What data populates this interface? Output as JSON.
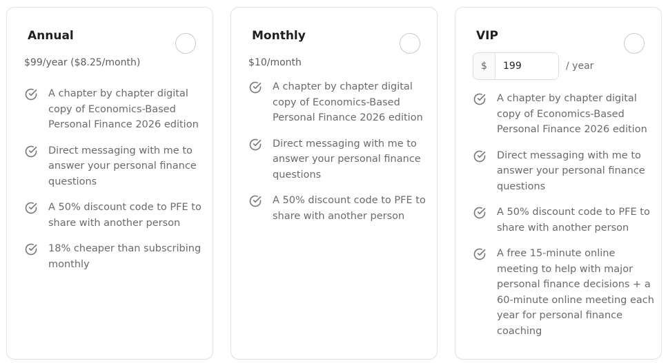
{
  "colors": {
    "border": "#e2e2e2",
    "text_muted": "#6a6a6a",
    "check_icon": "#7a7a7a"
  },
  "plans": [
    {
      "title": "Annual",
      "price": "$99/year ($8.25/month)",
      "features": [
        "A chapter by chapter digital copy of Economics-Based Personal Finance 2026 edition",
        "Direct messaging with me to answer your personal finance questions",
        "A 50% discount code to PFE to share with another person",
        "18% cheaper than subscribing monthly"
      ]
    },
    {
      "title": "Monthly",
      "price": "$10/month",
      "features": [
        "A chapter by chapter digital copy of Economics-Based Personal Finance 2026 edition",
        "Direct messaging with me to answer your personal finance questions",
        "A 50% discount code to PFE to share with another person"
      ]
    },
    {
      "title": "VIP",
      "currency": "$",
      "amount": "199",
      "period": "/ year",
      "features": [
        "A chapter by chapter digital copy of Economics-Based Personal Finance 2026 edition",
        "Direct messaging with me to answer your personal finance questions",
        "A 50% discount code to PFE to share with another person",
        "A free 15-minute online meeting to help with major personal finance decisions + a 60-minute online meeting each year for personal finance coaching"
      ]
    }
  ]
}
